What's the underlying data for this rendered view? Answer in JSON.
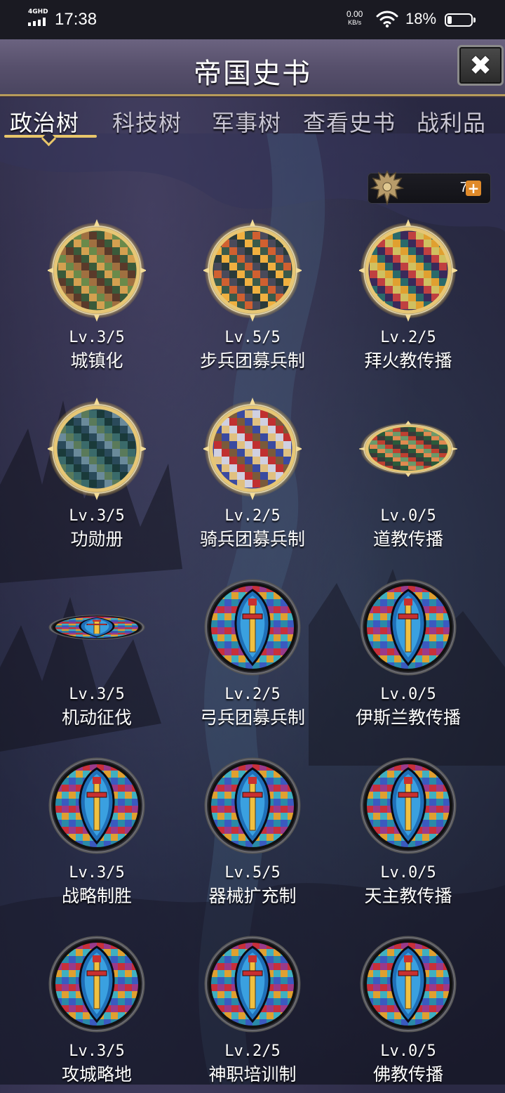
{
  "status_bar": {
    "network": "4GHD",
    "time": "17:38",
    "speed_value": "0.00",
    "speed_unit": "KB/s",
    "battery_percent": "18%"
  },
  "header": {
    "title": "帝国史书",
    "close_icon": "close-icon"
  },
  "tabs": [
    {
      "label": "政治树",
      "active": true
    },
    {
      "label": "科技树",
      "active": false
    },
    {
      "label": "军事树",
      "active": false
    },
    {
      "label": "查看史书",
      "active": false
    },
    {
      "label": "战利品",
      "active": false
    }
  ],
  "currency": {
    "icon": "double-headed-eagle-icon",
    "amount": "71",
    "add_icon": "plus-icon"
  },
  "nodes": [
    {
      "level": "Lv.3/5",
      "name": "城镇化",
      "art": "town-painting"
    },
    {
      "level": "Lv.5/5",
      "name": "步兵团募兵制",
      "art": "infantry-painting"
    },
    {
      "level": "Lv.2/5",
      "name": "拜火教传播",
      "art": "fire-temple-painting"
    },
    {
      "level": "Lv.3/5",
      "name": "功勋册",
      "art": "statue-painting"
    },
    {
      "level": "Lv.2/5",
      "name": "骑兵团募兵制",
      "art": "cavalry-painting"
    },
    {
      "level": "Lv.0/5",
      "name": "道教传播",
      "art": "taoist-temple-painting"
    },
    {
      "level": "Lv.3/5",
      "name": "机动征伐",
      "art": "stained-glass-sword"
    },
    {
      "level": "Lv.2/5",
      "name": "弓兵团募兵制",
      "art": "stained-glass-sword"
    },
    {
      "level": "Lv.0/5",
      "name": "伊斯兰教传播",
      "art": "stained-glass-sword"
    },
    {
      "level": "Lv.3/5",
      "name": "战略制胜",
      "art": "stained-glass-sword"
    },
    {
      "level": "Lv.5/5",
      "name": "器械扩充制",
      "art": "stained-glass-sword"
    },
    {
      "level": "Lv.0/5",
      "name": "天主教传播",
      "art": "stained-glass-sword"
    },
    {
      "level": "Lv.3/5",
      "name": "攻城略地",
      "art": "stained-glass-sword"
    },
    {
      "level": "Lv.2/5",
      "name": "神职培训制",
      "art": "stained-glass-sword"
    },
    {
      "level": "Lv.0/5",
      "name": "佛教传播",
      "art": "stained-glass-sword"
    }
  ],
  "colors": {
    "gold_frame": "#e6c675",
    "tab_underline": "#e8c66a",
    "plus_button": "#e08a2a"
  }
}
